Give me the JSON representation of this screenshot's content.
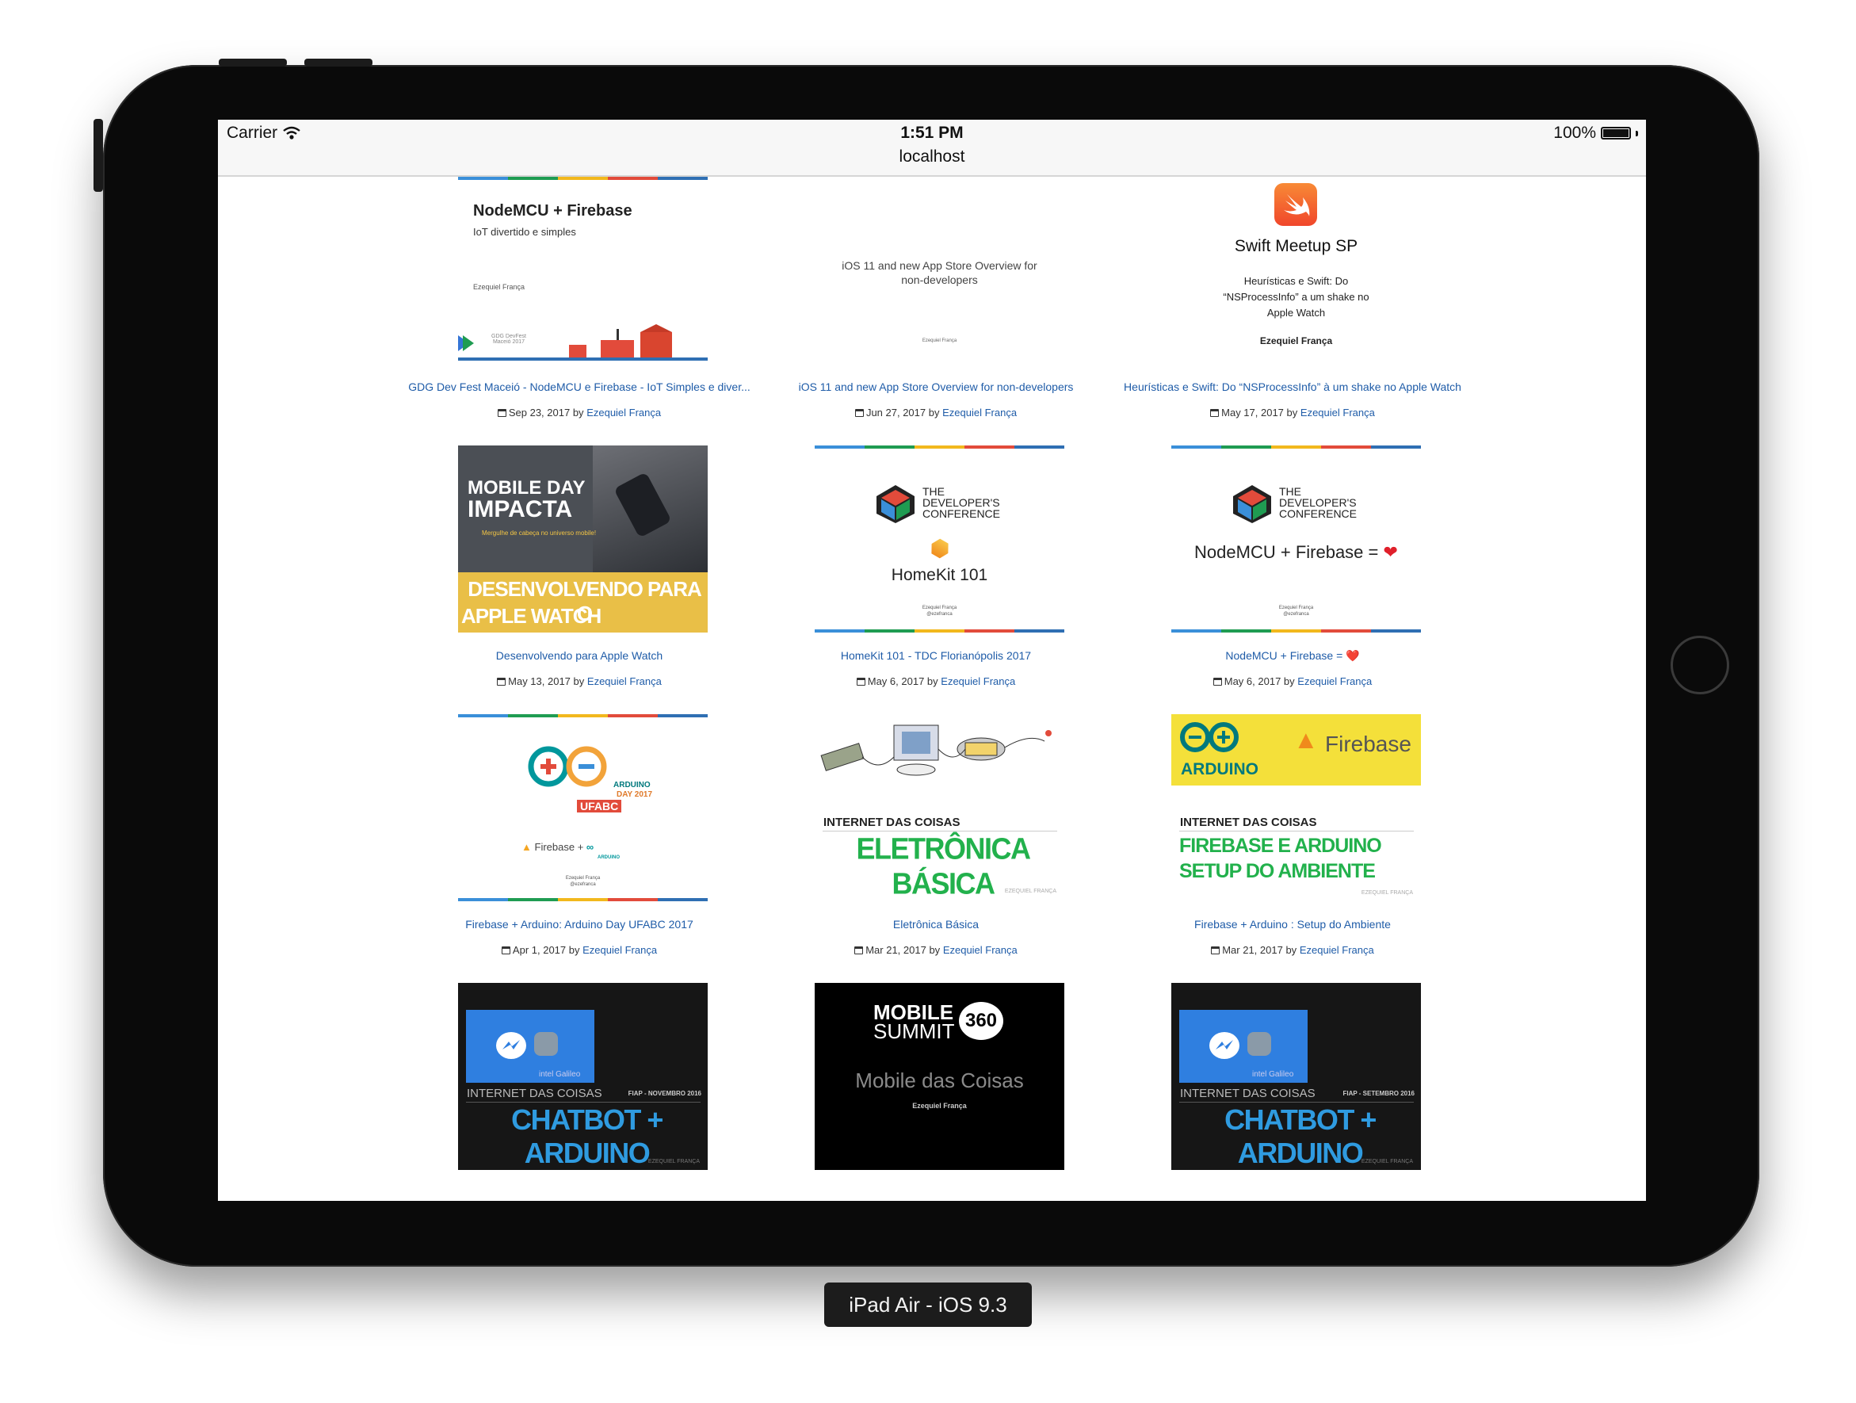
{
  "status_bar": {
    "carrier": "Carrier",
    "time": "1:51 PM",
    "battery": "100%"
  },
  "browser": {
    "url": "localhost"
  },
  "device_label": "iPad Air - iOS 9.3",
  "posts": [
    {
      "title": "GDG Dev Fest Maceió - NodeMCU e Firebase - IoT Simples e diver...",
      "date": "Sep 23, 2017",
      "by": "by",
      "author": "Ezequiel França",
      "thumb": {
        "heading": "NodeMCU + Firebase",
        "sub": "IoT divertido e simples",
        "author": "Ezequiel França",
        "footer": "GDG DevFest Maceió 2017"
      }
    },
    {
      "title": "iOS 11 and new App Store Overview for non-developers",
      "date": "Jun 27, 2017",
      "by": "by",
      "author": "Ezequiel França",
      "thumb": {
        "line1": "iOS 11 and new App Store Overview for",
        "line2": "non-developers",
        "author": "Ezequiel França"
      }
    },
    {
      "title": "Heurísticas e Swift: Do “NSProcessInfo” à um shake no Apple Watch",
      "date": "May 17, 2017",
      "by": "by",
      "author": "Ezequiel França",
      "thumb": {
        "heading": "Swift Meetup SP",
        "line1": "Heurísticas e Swift: Do",
        "line2": "“NSProcessInfo” a um shake no",
        "line3": "Apple Watch",
        "author": "Ezequiel França"
      }
    },
    {
      "title": "Desenvolvendo para Apple Watch",
      "date": "May 13, 2017",
      "by": "by",
      "author": "Ezequiel França",
      "thumb": {
        "line1": "MOBILE DAY",
        "line2": "IMPACTA",
        "tagline": "Mergulhe de cabeça no universo mobile!",
        "line3": "DESENVOLVENDO PARA O",
        "line4": "APPLE WATCH"
      }
    },
    {
      "title": "HomeKit 101 - TDC Florianópolis 2017",
      "date": "May 6, 2017",
      "by": "by",
      "author": "Ezequiel França",
      "thumb": {
        "conf1": "THE",
        "conf2": "DEVELOPER'S",
        "conf3": "CONFERENCE",
        "heading": "HomeKit 101",
        "author": "Ezequiel França",
        "handle": "@ezefranca"
      }
    },
    {
      "title": "NodeMCU + Firebase = ❤️",
      "date": "May 6, 2017",
      "by": "by",
      "author": "Ezequiel França",
      "thumb": {
        "conf1": "THE",
        "conf2": "DEVELOPER'S",
        "conf3": "CONFERENCE",
        "heading": "NodeMCU + Firebase =",
        "author": "Ezequiel França",
        "handle": "@ezefranca"
      }
    },
    {
      "title": "Firebase + Arduino: Arduino Day UFABC 2017",
      "date": "Apr 1, 2017",
      "by": "by",
      "author": "Ezequiel França",
      "thumb": {
        "l1": "ARDUINO",
        "l2": "DAY 2017",
        "l3": "UFABC",
        "firebase": "Firebase",
        "arduino": "ARDUINO",
        "author": "Ezequiel França",
        "handle": "@ezefranca"
      }
    },
    {
      "title": "Eletrônica Básica",
      "date": "Mar 21, 2017",
      "by": "by",
      "author": "Ezequiel França",
      "thumb": {
        "kicker": "INTERNET DAS COISAS",
        "heading": "ELETRÔNICA BÁSICA",
        "author": "EZEQUIEL FRANÇA"
      }
    },
    {
      "title": "Firebase + Arduino : Setup do Ambiente",
      "date": "Mar 21, 2017",
      "by": "by",
      "author": "Ezequiel França",
      "thumb": {
        "arduino": "ARDUINO",
        "firebase": "Firebase",
        "kicker": "INTERNET DAS COISAS",
        "line1": "FIREBASE E ARDUINO",
        "line2": "SETUP DO AMBIENTE",
        "author": "EZEQUIEL FRANÇA"
      }
    },
    {
      "title": "",
      "date": "",
      "by": "",
      "author": "",
      "thumb": {
        "brand": "intel Galileo",
        "kicker": "INTERNET DAS COISAS",
        "event": "FIAP - NOVEMBRO 2016",
        "heading": "CHATBOT + ARDUINO",
        "author": "EZEQUIEL FRANÇA"
      }
    },
    {
      "title": "",
      "date": "",
      "by": "",
      "author": "",
      "thumb": {
        "l1": "MOBILE",
        "l2": "SUMMIT",
        "badge": "360",
        "heading": "Mobile das Coisas",
        "author": "Ezequiel França"
      }
    },
    {
      "title": "",
      "date": "",
      "by": "",
      "author": "",
      "thumb": {
        "brand": "intel Galileo",
        "kicker": "INTERNET DAS COISAS",
        "event": "FIAP - SETEMBRO 2016",
        "heading": "CHATBOT + ARDUINO",
        "author": "EZEQUIEL FRANÇA"
      }
    }
  ],
  "colors": {
    "link": "#1f5ca8",
    "arduino_teal": "#00979c",
    "firebase_yellow": "#f4e03a",
    "green_title": "#22b14c",
    "chatbot_blue": "#2f9be0"
  }
}
